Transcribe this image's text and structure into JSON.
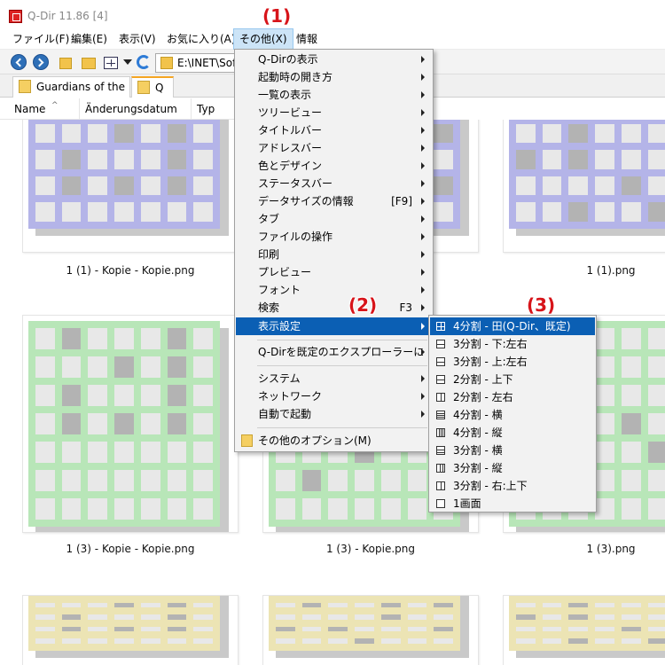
{
  "window": {
    "title": "Q-Dir 11.86 [4]"
  },
  "menubar": {
    "items": [
      {
        "label": "ファイル(F)"
      },
      {
        "label": "編集(E)"
      },
      {
        "label": "表示(V)"
      },
      {
        "label": "お気に入り(A)"
      },
      {
        "label": "その他(X)"
      },
      {
        "label": "情報"
      }
    ]
  },
  "toolbar": {
    "address": "E:\\INET\\Soft"
  },
  "tabs": [
    {
      "label": "Guardians of the ..."
    },
    {
      "label": "Q"
    }
  ],
  "columns": {
    "name": "Name",
    "date": "Änderungsdatum",
    "type": "Typ"
  },
  "files": [
    {
      "caption": "1 (1) - Kopie - Kopie.png",
      "color": "#b4b4e8"
    },
    {
      "caption": "",
      "color": "#b4b4e8"
    },
    {
      "caption": "1 (1).png",
      "color": "#b4b4e8"
    },
    {
      "caption": "1 (3) - Kopie - Kopie.png",
      "color": "#b8e6b8"
    },
    {
      "caption": "1 (3) - Kopie.png",
      "color": "#b8e6b8"
    },
    {
      "caption": "1 (3).png",
      "color": "#b8e6b8"
    },
    {
      "caption": "",
      "color": "#ece4b4"
    },
    {
      "caption": "",
      "color": "#ece4b4"
    },
    {
      "caption": "",
      "color": "#ece4b4"
    }
  ],
  "menu": {
    "items": [
      {
        "label": "Q-Dirの表示"
      },
      {
        "label": "起動時の開き方"
      },
      {
        "label": "一覧の表示"
      },
      {
        "label": "ツリービュー"
      },
      {
        "label": "タイトルバー"
      },
      {
        "label": "アドレスバー"
      },
      {
        "label": "色とデザイン"
      },
      {
        "label": "ステータスバー"
      },
      {
        "label": "データサイズの情報",
        "shortcut": "[F9]"
      },
      {
        "label": "タブ"
      },
      {
        "label": "ファイルの操作"
      },
      {
        "label": "印刷"
      },
      {
        "label": "プレビュー"
      },
      {
        "label": "フォント"
      },
      {
        "label": "検索",
        "shortcut": "F3"
      },
      {
        "label": "表示設定"
      },
      {
        "label": "Q-Dirを既定のエクスプローラーに"
      },
      {
        "label": "システム"
      },
      {
        "label": "ネットワーク"
      },
      {
        "label": "自動で起動"
      },
      {
        "label": "その他のオプション(M)"
      }
    ]
  },
  "submenu": {
    "items": [
      {
        "label": "4分割 - 田(Q-Dir、既定)",
        "icon": "four-quadrant-icon"
      },
      {
        "label": "3分割 - 下:左右",
        "icon": "three-pane-icon"
      },
      {
        "label": "3分割 - 上:左右",
        "icon": "three-pane-icon"
      },
      {
        "label": "2分割 - 上下",
        "icon": "two-horizontal-icon"
      },
      {
        "label": "2分割 - 左右",
        "icon": "two-vertical-icon"
      },
      {
        "label": "4分割 - 横",
        "icon": "four-rows-icon"
      },
      {
        "label": "4分割 - 縦",
        "icon": "four-columns-icon"
      },
      {
        "label": "3分割 - 横",
        "icon": "three-rows-icon"
      },
      {
        "label": "3分割 - 縦",
        "icon": "three-columns-icon"
      },
      {
        "label": "3分割 - 右:上下",
        "icon": "three-pane-icon"
      },
      {
        "label": "1画面",
        "icon": "single-pane-icon"
      }
    ]
  },
  "steps": {
    "one": "(1)",
    "two": "(2)",
    "three": "(3)"
  },
  "colors": {
    "highlight": "#0b5fb4",
    "annotation": "#d7141a"
  }
}
